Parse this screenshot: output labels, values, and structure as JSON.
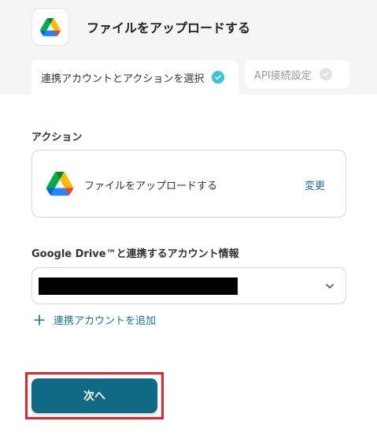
{
  "header": {
    "app_icon": "google-drive-icon",
    "title": "ファイルをアップロードする"
  },
  "tabs": [
    {
      "label": "連携アカウントとアクションを選択",
      "state": "active",
      "icon": "check-circle-icon"
    },
    {
      "label": "API接続設定",
      "state": "inactive",
      "icon": "check-circle-icon"
    }
  ],
  "action_section": {
    "label": "アクション",
    "action_name": "ファイルをアップロードする",
    "change_label": "変更"
  },
  "account_section": {
    "label": "Google Drive™と連携するアカウント情報",
    "selected_value": "",
    "add_account_label": "連携アカウントを追加"
  },
  "footer": {
    "next_label": "次へ"
  },
  "colors": {
    "accent": "#106985",
    "link": "#1f6e8c",
    "check_active": "#37c3dc",
    "highlight": "#e0262e"
  }
}
